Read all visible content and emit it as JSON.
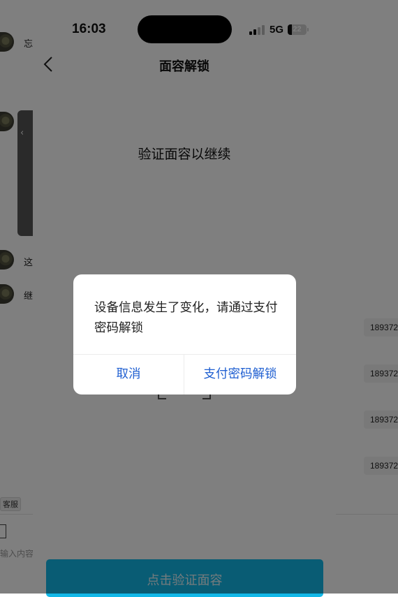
{
  "status_bar": {
    "time": "16:03",
    "network": "5G",
    "battery": "22",
    "battery_level": 0.22
  },
  "background_chat": {
    "snippets": [
      "忘",
      "这",
      "继"
    ],
    "phone_chips": [
      "189372",
      "189372",
      "189372",
      "189372"
    ],
    "service_tag": "客服",
    "input_placeholder": "输入内容"
  },
  "face_page": {
    "nav_title": "面容解锁",
    "prompt": "验证面容以继续",
    "verify_button": "点击验证面容"
  },
  "dialog": {
    "message": "设备信息发生了变化，请通过支付密码解锁",
    "cancel_label": "取消",
    "confirm_label": "支付密码解锁"
  },
  "colors": {
    "accent_button": "#12b8e8",
    "dialog_link": "#1f5fd1",
    "overlay": "rgba(0,0,0,0.5)"
  },
  "icons": {
    "back": "chevron-left-icon",
    "signal": "cellular-signal-icon",
    "battery": "battery-icon",
    "face_frame": "face-scan-frame-icon"
  }
}
